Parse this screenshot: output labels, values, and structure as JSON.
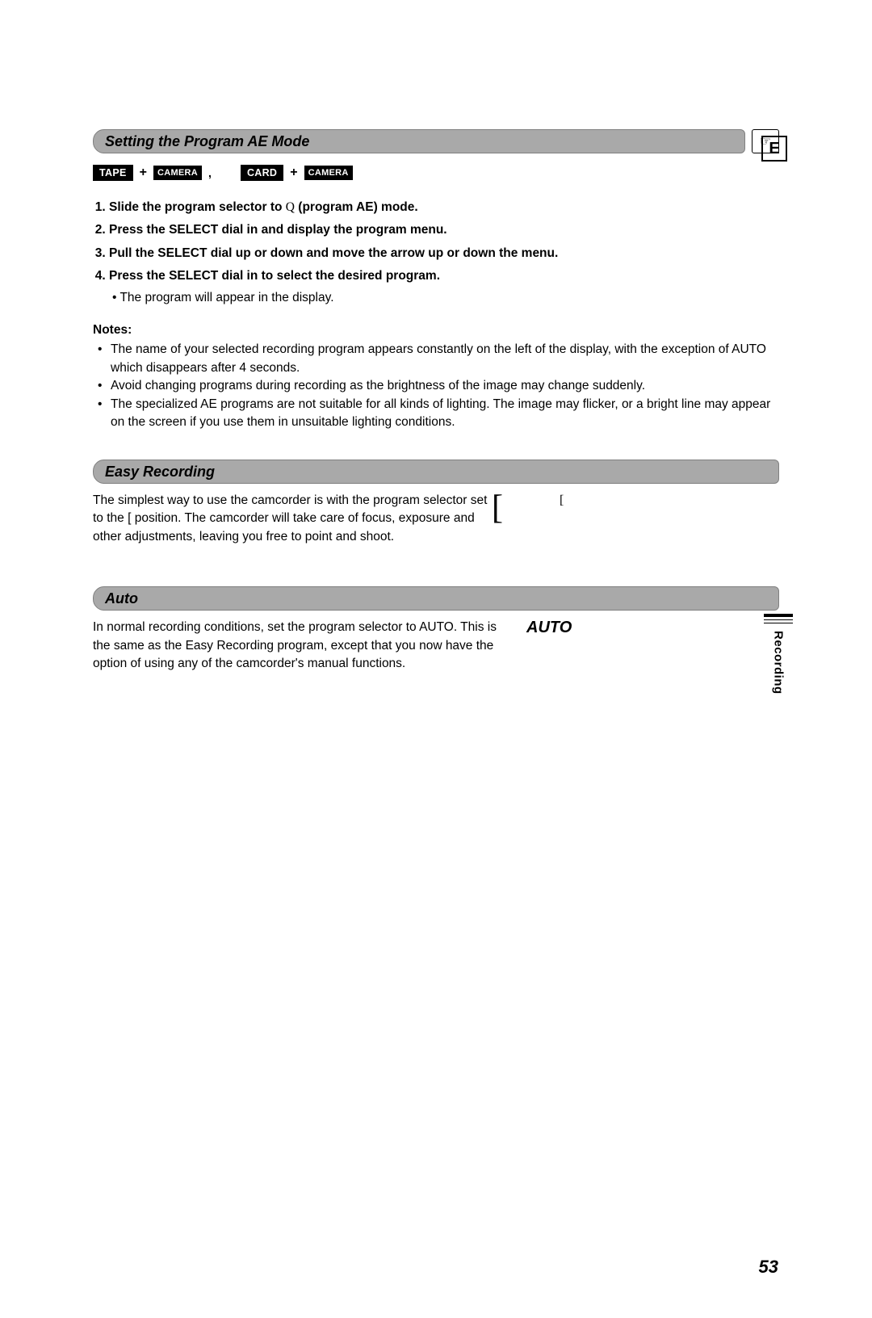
{
  "lang_letter": "E",
  "hand_glyph": "☞",
  "section1": {
    "title": "Setting the Program AE Mode",
    "tags": {
      "tape": "TAPE",
      "camera": "CAMERA",
      "card": "CARD",
      "plus": "+",
      "comma": ","
    },
    "steps": [
      {
        "pre": "Slide the program selector to ",
        "sym": "Q",
        "post": " (program AE) mode."
      },
      {
        "pre": "Press the SELECT dial in and display the program menu."
      },
      {
        "pre": "Pull the SELECT dial up or down and move the arrow up or down the menu."
      },
      {
        "pre": "Press the SELECT dial in to select the desired program.",
        "sub": "The program will appear in the display."
      }
    ],
    "notes_label": "Notes:",
    "notes": [
      "The name of your selected recording program appears constantly on the left of the display, with the exception of AUTO which disappears after 4 seconds.",
      "Avoid changing programs during recording as the brightness of the image may change suddenly.",
      "The specialized AE programs are not suitable for all kinds of lighting. The image may flicker, or a bright line may appear on the screen if you use them in unsuitable lighting conditions."
    ]
  },
  "section2": {
    "title": "Easy Recording",
    "body": "The simplest way to use the camcorder is with the program selector set to the [    position. The camcorder will take care of focus, exposure and other adjustments, leaving you free to point and shoot.",
    "bracket_big": "[",
    "bracket_small": "["
  },
  "section3": {
    "title": "Auto",
    "body": "In normal recording conditions, set the program selector to AUTO. This is the same as the Easy Recording program, except that you now have the option of using any of the camcorder's manual functions.",
    "indicator": "AUTO"
  },
  "side_tab": "Recording",
  "page_number": "53"
}
